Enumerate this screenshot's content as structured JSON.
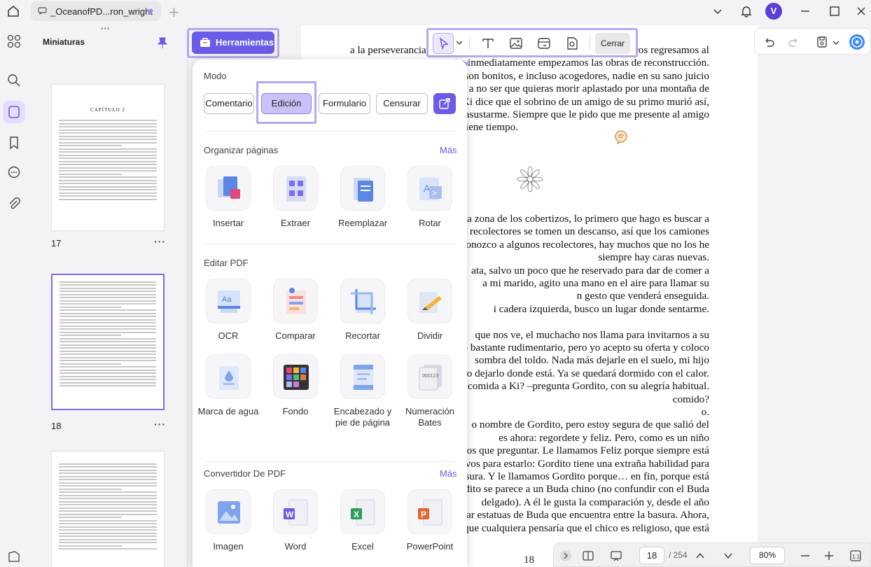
{
  "window": {
    "tab_title": "_OceanofPD...ron_wright",
    "avatar_letter": "V"
  },
  "sidebar": {
    "title": "Miniaturas",
    "pages": [
      {
        "number": "17"
      },
      {
        "number": "18"
      }
    ],
    "page17_heading": "CAPÍTULO 2"
  },
  "tools_button": {
    "label": "Herramientas"
  },
  "tools_panel": {
    "mode_title": "Modo",
    "modes": [
      "Comentario",
      "Edición",
      "Formulario",
      "Censurar"
    ],
    "active_mode": "Edición",
    "organize": {
      "title": "Organizar páginas",
      "more": "Más",
      "items": [
        "Insertar",
        "Extraer",
        "Reemplazar",
        "Rotar"
      ]
    },
    "edit": {
      "title": "Editar PDF",
      "items": [
        "OCR",
        "Comparar",
        "Recortar",
        "Dividir",
        "Marca de agua",
        "Fondo",
        "Encabezado y pie de página",
        "Numeración Bates"
      ]
    },
    "convert": {
      "title": "Convertidor De PDF",
      "more": "Más",
      "items": [
        "Imagen",
        "Word",
        "Excel",
        "PowerPoint"
      ]
    }
  },
  "edit_toolbar": {
    "close_label": "Cerrar"
  },
  "document": {
    "lines_top": [
      "a la perseverancia.",
      "inmediatamente empezamos las obras de reconstrucción.",
      "os son bonitos, e incluso acogedores, nadie en su sano juicio",
      "s; a no ser que quieras morir aplastado por una montaña de",
      "Ki dice que el sobrino de un amigo de su primo murió así,",
      "de asustarme. Siempre que le pido que me presente al amigo",
      "tiene tiempo."
    ],
    "first_line_tail": "ros regresamos al",
    "lines_bottom": [
      "a la zona de los cobertizos, lo primero que hago es buscar a",
      "s recolectores se tomen un descanso, así que los camiones",
      "reconozco a algunos recolectores, hay muchos que no los he",
      "siempre hay caras nuevas.",
      "ata, salvo un poco que he reservado para dar de comer a",
      "a mi marido, agito una mano en el aire para llamar su",
      "n gesto que venderá enseguida.",
      "i cadera izquierda, busco un lugar donde sentarme.",
      "",
      "que nos ve, el muchacho nos llama para invitarnos a su",
      "gio bastante rudimentario, pero yo acepto su oferta y coloco",
      "sombra del toldo. Nada más dejarle en el suelo, mi hijo",
      "odido dejarlo donde está. Ya se quedará dormido con el calor.",
      "a comida a Ki? –pregunta Gordito, con su alegría habitual.",
      "comido?",
      "o.",
      "o nombre de Gordito, pero estoy segura de que salió del",
      "es ahora: regordete y feliz. Pero, como es un niño",
      ", los que preguntar. Le llamamos Feliz porque siempre está",
      "tivos para estarlo: Gordito tiene una extraña habilidad para",
      "basura. Y le llamamos Gordito porque… en fin, porque está",
      "ordito se parece a un Buda chino (no confundir con el Buda",
      "delgado). A él le gusta la comparación y, desde el año",
      "ntrar estatuas de Buda que encuentra entre la basura. Ahora,",
      "as que cualquiera pensaría que el chico es religioso, que está"
    ],
    "page_number": "18"
  },
  "bottom_bar": {
    "current_page": "18",
    "total_pages": "/ 254",
    "zoom": "80%"
  },
  "colors": {
    "accent": "#6b5ce7",
    "highlight": "#b3a9f0",
    "active_mode_bg": "#c9c2f9"
  }
}
